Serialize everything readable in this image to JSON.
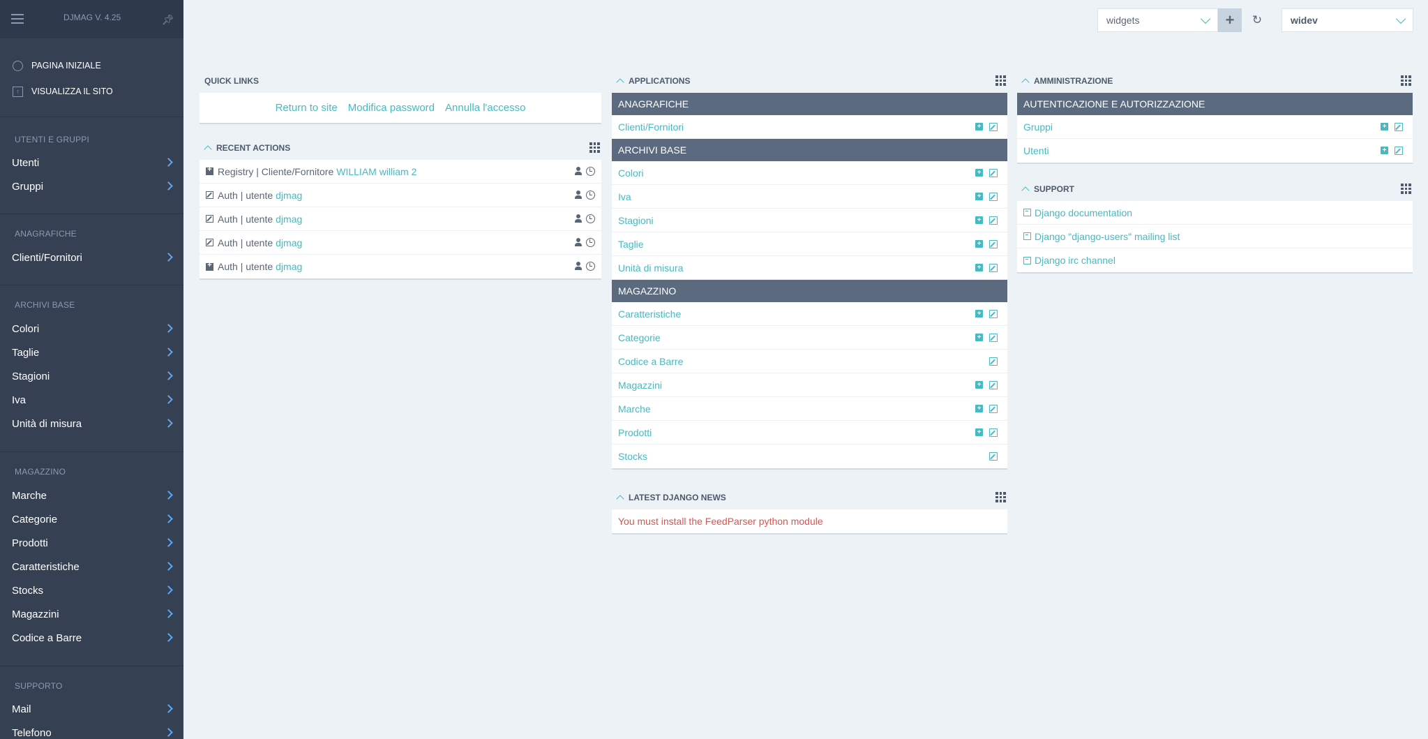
{
  "app": {
    "version": "DJMAG V. 4.25"
  },
  "sidebar": {
    "top_links": [
      {
        "label": "PAGINA INIZIALE",
        "icon": "home-circle-icon"
      },
      {
        "label": "VISUALIZZA IL SITO",
        "icon": "external-site-icon"
      }
    ],
    "groups": [
      {
        "title": "UTENTI E GRUPPI",
        "items": [
          "Utenti",
          "Gruppi"
        ]
      },
      {
        "title": "ANAGRAFICHE",
        "items": [
          "Clienti/Fornitori"
        ]
      },
      {
        "title": "ARCHIVI BASE",
        "items": [
          "Colori",
          "Taglie",
          "Stagioni",
          "Iva",
          "Unità di misura"
        ]
      },
      {
        "title": "MAGAZZINO",
        "items": [
          "Marche",
          "Categorie",
          "Prodotti",
          "Caratteristiche",
          "Stocks",
          "Magazzini",
          "Codice a Barre"
        ]
      },
      {
        "title": "SUPPORTO",
        "items": [
          "Mail",
          "Telefono"
        ]
      }
    ]
  },
  "topbar": {
    "widgets_select": "widgets",
    "user_select": "widev"
  },
  "quick_links": {
    "title": "QUICK LINKS",
    "links": [
      "Return to site",
      "Modifica password",
      "Annulla l'accesso"
    ]
  },
  "recent_actions": {
    "title": "RECENT ACTIONS",
    "rows": [
      {
        "type": "add",
        "text": "Registry | Cliente/Fornitore",
        "link": "WILLIAM william 2"
      },
      {
        "type": "edit",
        "text": "Auth | utente",
        "link": "djmag"
      },
      {
        "type": "edit",
        "text": "Auth | utente",
        "link": "djmag"
      },
      {
        "type": "edit",
        "text": "Auth | utente",
        "link": "djmag"
      },
      {
        "type": "add",
        "text": "Auth | utente",
        "link": "djmag"
      }
    ]
  },
  "applications": {
    "title": "APPLICATIONS",
    "sections": [
      {
        "title": "ANAGRAFICHE",
        "models": [
          {
            "name": "Clienti/Fornitori",
            "add": true
          }
        ]
      },
      {
        "title": "ARCHIVI BASE",
        "models": [
          {
            "name": "Colori",
            "add": true
          },
          {
            "name": "Iva",
            "add": true
          },
          {
            "name": "Stagioni",
            "add": true
          },
          {
            "name": "Taglie",
            "add": true
          },
          {
            "name": "Unità di misura",
            "add": true
          }
        ]
      },
      {
        "title": "MAGAZZINO",
        "models": [
          {
            "name": "Caratteristiche",
            "add": true
          },
          {
            "name": "Categorie",
            "add": true
          },
          {
            "name": "Codice a Barre",
            "add": false
          },
          {
            "name": "Magazzini",
            "add": true
          },
          {
            "name": "Marche",
            "add": true
          },
          {
            "name": "Prodotti",
            "add": true
          },
          {
            "name": "Stocks",
            "add": false
          }
        ]
      }
    ]
  },
  "news": {
    "title": "LATEST DJANGO NEWS",
    "message": "You must install the FeedParser python module"
  },
  "administration": {
    "title": "AMMINISTRAZIONE",
    "section": "AUTENTICAZIONE E AUTORIZZAZIONE",
    "models": [
      {
        "name": "Gruppi",
        "add": true
      },
      {
        "name": "Utenti",
        "add": true
      }
    ]
  },
  "support": {
    "title": "SUPPORT",
    "links": [
      "Django documentation",
      "Django \"django-users\" mailing list",
      "Django irc channel"
    ]
  },
  "colors": {
    "sidebar": "#354052",
    "accent": "#47bac1",
    "header": "#5c6a80",
    "background": "#ecf2f6",
    "error": "#d9534f"
  }
}
